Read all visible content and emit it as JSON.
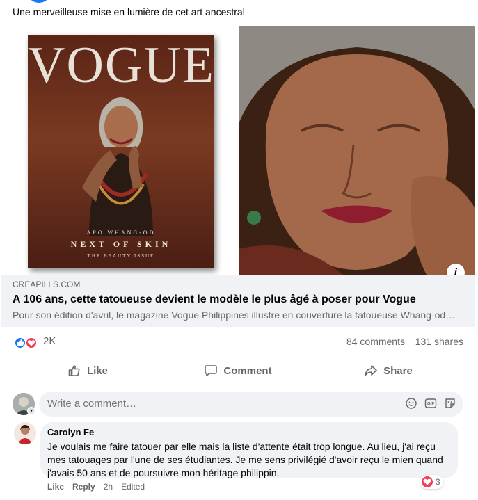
{
  "post": {
    "text": "Une merveilleuse mise en lumière de cet art ancestral"
  },
  "media": {
    "cover": {
      "masthead": "VOGUE",
      "name_line": "APO WHANG-OD",
      "headline": "NEXT OF SKIN",
      "issue_line": "THE BEAUTY ISSUE"
    },
    "info_icon": "i"
  },
  "link": {
    "domain": "CREAPILLS.COM",
    "title": "A 106 ans, cette tatoueuse devient le modèle le plus âgé à poser pour Vogue",
    "description": "Pour son édition d'avril, le magazine Vogue Philippines illustre en couverture la tatoueuse Whang-od…"
  },
  "stats": {
    "reaction_count": "2K",
    "comments": "84 comments",
    "shares": "131 shares"
  },
  "actions": {
    "like": "Like",
    "comment": "Comment",
    "share": "Share"
  },
  "compose": {
    "placeholder": "Write a comment…",
    "gif_label": "GIF"
  },
  "comments": [
    {
      "author": "Carolyn Fe",
      "text": "Je voulais me faire tatouer par elle mais la liste d'attente était trop longue. Au lieu, j'ai reçu mes tatouages par l'une de ses étudiantes. Je me sens privilégié d'avoir reçu le mien quand j'avais 50 ans et de poursuivre mon héritage philippin.",
      "reaction_count": "3",
      "like_label": "Like",
      "reply_label": "Reply",
      "time": "2h",
      "edited": "Edited"
    }
  ],
  "colors": {
    "brand_blue": "#1877f2",
    "love_red": "#f33e58",
    "muted_text": "#65676b",
    "bubble_bg": "#f0f2f5"
  }
}
